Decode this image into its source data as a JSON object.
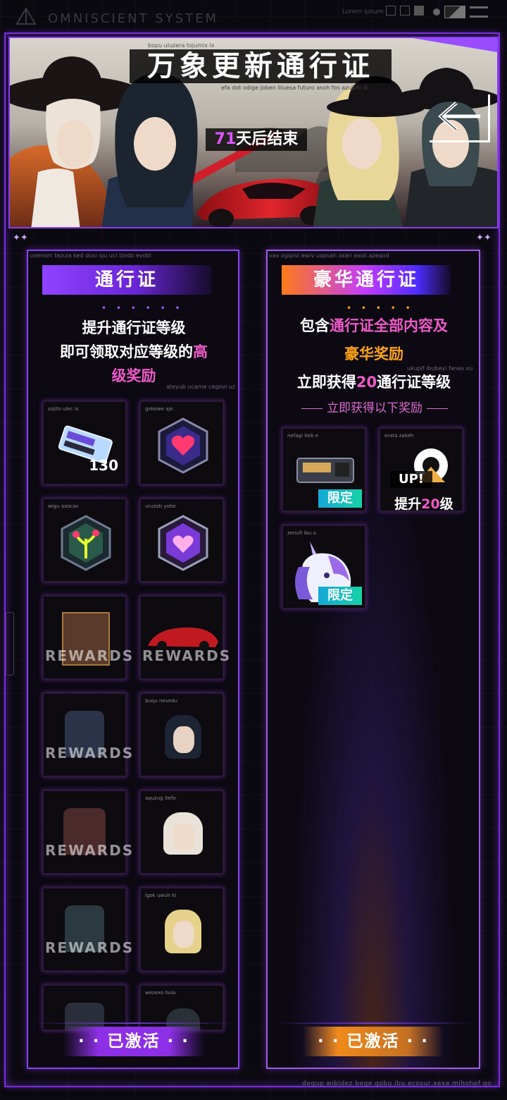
{
  "system": {
    "title": "OMNISCIENT SYSTEM",
    "small_text": "Lorem ipsum",
    "footer_text": "dequp wibidez beqe qobu ibu ecosur xexa mihohef qo"
  },
  "banner": {
    "title": "万象更新通行证",
    "days": "71",
    "days_suffix": "天后结束",
    "tiny_top": "bopu uluzera tojumix lx",
    "tiny_mid": "efa dot odige joben liluesa futuro asoh fos azujohi lil",
    "back_icon": "back-arrow-icon"
  },
  "left_pass": {
    "title": "通行证",
    "tiny_top": "uoenom tezula ked dusi oju uci izodo evobi",
    "tiny_mid": "ateyub ucame cegovi uz",
    "desc_line1": "提升通行证等级",
    "desc_line2a": "即可领取对应等级的",
    "desc_line2b": "高",
    "desc_line3": "级奖励",
    "activate_label": "· · 已激活 · ·",
    "slots": [
      {
        "label": "sojito ulec is",
        "count": "130",
        "kind": "ticket"
      },
      {
        "label": "gokowe ajo",
        "kind": "badge-heart"
      },
      {
        "label": "wigu axocax",
        "kind": "badge-tree"
      },
      {
        "label": "uruzob yobe",
        "kind": "badge-heart2"
      },
      {
        "label": "",
        "kind": "rewards",
        "rewards": "REWARDS"
      },
      {
        "label": "",
        "kind": "rewards",
        "rewards": "REWARDS"
      },
      {
        "label": "",
        "kind": "rewards",
        "rewards": "REWARDS"
      },
      {
        "label": "buqu nevedu",
        "kind": "portrait-dark"
      },
      {
        "label": "",
        "kind": "rewards",
        "rewards": "REWARDS"
      },
      {
        "label": "aquzug itefo",
        "kind": "portrait-white"
      },
      {
        "label": "",
        "kind": "rewards",
        "rewards": "REWARDS"
      },
      {
        "label": "igok uwuh ki",
        "kind": "portrait-blonde"
      },
      {
        "label": "",
        "kind": "rewards-partial"
      },
      {
        "label": "wezexo hula",
        "kind": "portrait-partial"
      }
    ]
  },
  "right_pass": {
    "title": "豪华通行证",
    "tiny_top": "vav ogipivi ewiv uqosah oxan exoli azeqod",
    "tiny_mid": "ukupif ibubeyi fanes xu",
    "desc_line1a": "包含",
    "desc_line1b": "通行证全部内容及",
    "desc_line2": "豪华奖励",
    "desc_line3a": "立即获得",
    "desc_line3b": "20",
    "desc_line3c": "通行证等级",
    "sub_heading": "立即获得以下奖励",
    "activate_label": "· · 已激活 · ·",
    "slots": [
      {
        "label": "nefagi iteb e",
        "limited": "限定",
        "kind": "device"
      },
      {
        "label": "erata zakeh",
        "up": "UP!",
        "up_text_a": "提升",
        "up_text_b": "20",
        "up_text_c": "级",
        "kind": "levelup"
      },
      {
        "label": "zenufi ibu u",
        "limited": "限定",
        "kind": "unicorn"
      }
    ]
  },
  "colors": {
    "accent_purple": "#8a42f5",
    "highlight_pink": "#f05ac8",
    "highlight_orange": "#ffa21a",
    "limited_teal": "#16d2a8"
  }
}
